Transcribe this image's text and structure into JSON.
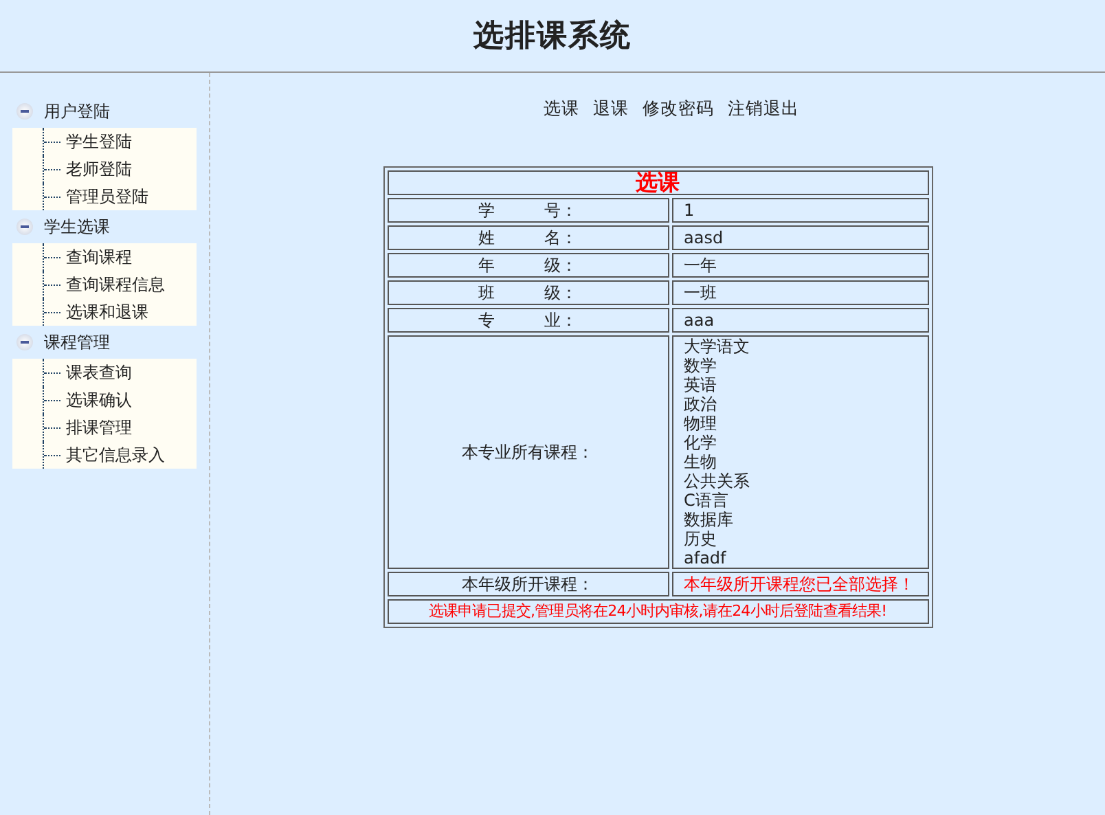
{
  "header": {
    "title": "选排课系统"
  },
  "sidebar": {
    "groups": [
      {
        "label": "用户登陆",
        "expanded": true,
        "items": [
          "学生登陆",
          "老师登陆",
          "管理员登陆"
        ]
      },
      {
        "label": "学生选课",
        "expanded": true,
        "items": [
          "查询课程",
          "查询课程信息",
          "选课和退课"
        ]
      },
      {
        "label": "课程管理",
        "expanded": true,
        "items": [
          "课表查询",
          "选课确认",
          "排课管理",
          "其它信息录入"
        ]
      }
    ]
  },
  "top_links": [
    "选课",
    "退课",
    "修改密码",
    "注销退出"
  ],
  "form": {
    "title": "选课",
    "rows": [
      {
        "label": "学　　　号：",
        "value": "1"
      },
      {
        "label": "姓　　　名：",
        "value": "aasd"
      },
      {
        "label": "年　　　级：",
        "value": "一年"
      },
      {
        "label": "班　　　级：",
        "value": "一班"
      },
      {
        "label": "专　　　业：",
        "value": "aaa"
      }
    ],
    "courses_label": "本专业所有课程：",
    "courses": [
      "大学语文",
      "数学",
      "英语",
      "政治",
      "物理",
      "化学",
      "生物",
      "公共关系",
      "C语言",
      "数据库",
      "历史",
      "afadf"
    ],
    "grade_label": "本年级所开课程：",
    "grade_value": "本年级所开课程您已全部选择！",
    "notice": "选课申请已提交,管理员将在24小时内审核,请在24小时后登陆查看结果!"
  }
}
